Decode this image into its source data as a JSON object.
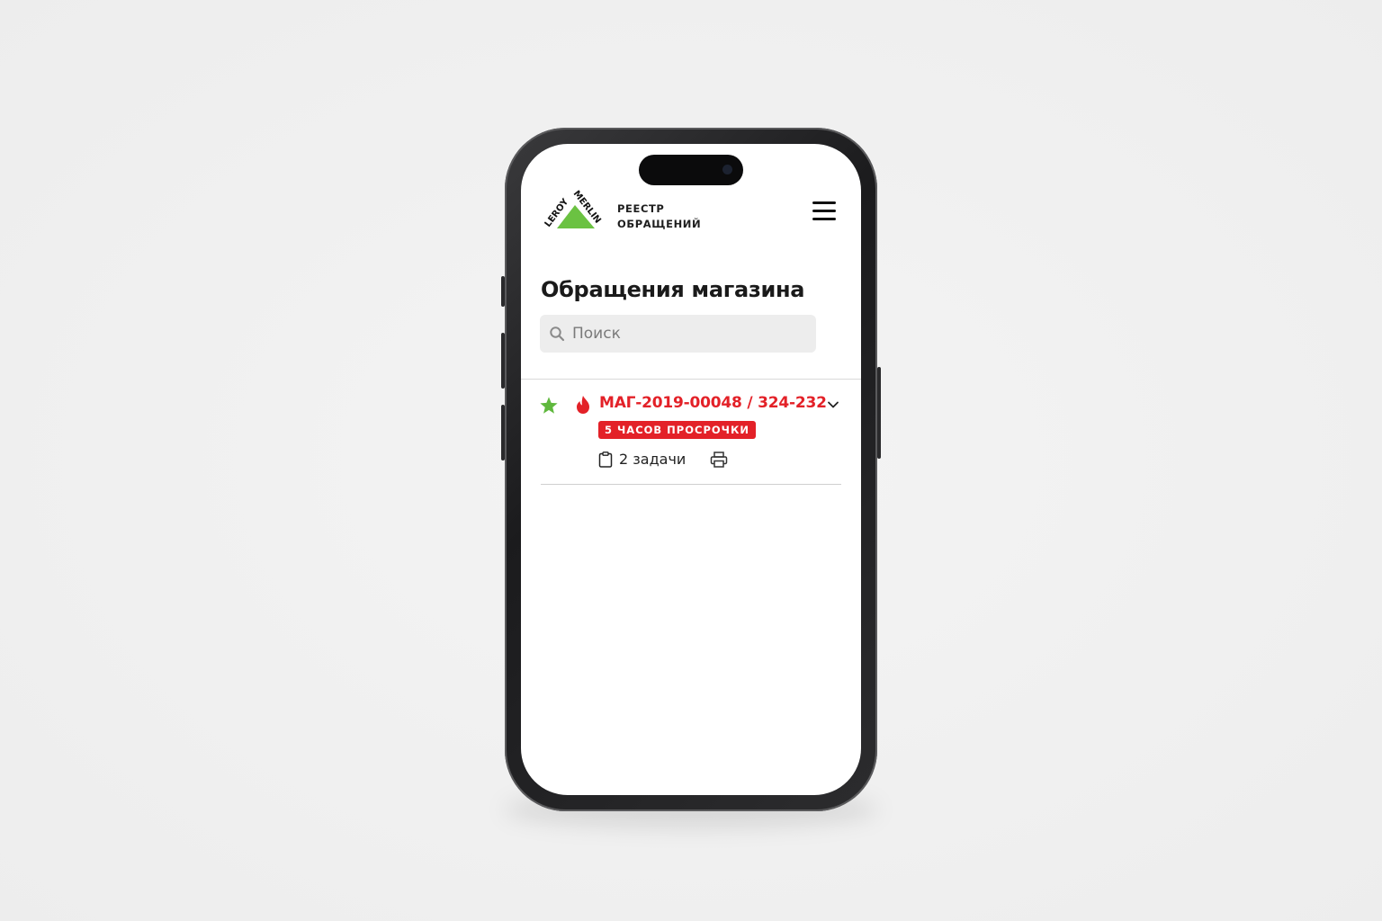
{
  "header": {
    "logo_text_left": "LEROY",
    "logo_text_right": "MERLIN",
    "app_title_line1": "РЕЕСТР",
    "app_title_line2": "ОБРАЩЕНИЙ",
    "menu_icon": "hamburger-icon"
  },
  "page": {
    "title": "Обращения магазина"
  },
  "search": {
    "placeholder": "Поиск",
    "value": "",
    "icon": "search-icon"
  },
  "tickets": [
    {
      "id_label": "МАГ-2019-00048 / 324-232",
      "favorite": true,
      "urgent": true,
      "overdue_badge": "5 ЧАСОВ ПРОСРОЧКИ",
      "tasks_label": "2 задачи",
      "icons": [
        "star-icon",
        "fire-icon",
        "chevron-down-icon",
        "clipboard-icon",
        "printer-icon"
      ]
    }
  ],
  "colors": {
    "brand_green": "#6bc242",
    "accent_red": "#e32128",
    "background": "#ffffff",
    "search_bg": "#ededed"
  }
}
